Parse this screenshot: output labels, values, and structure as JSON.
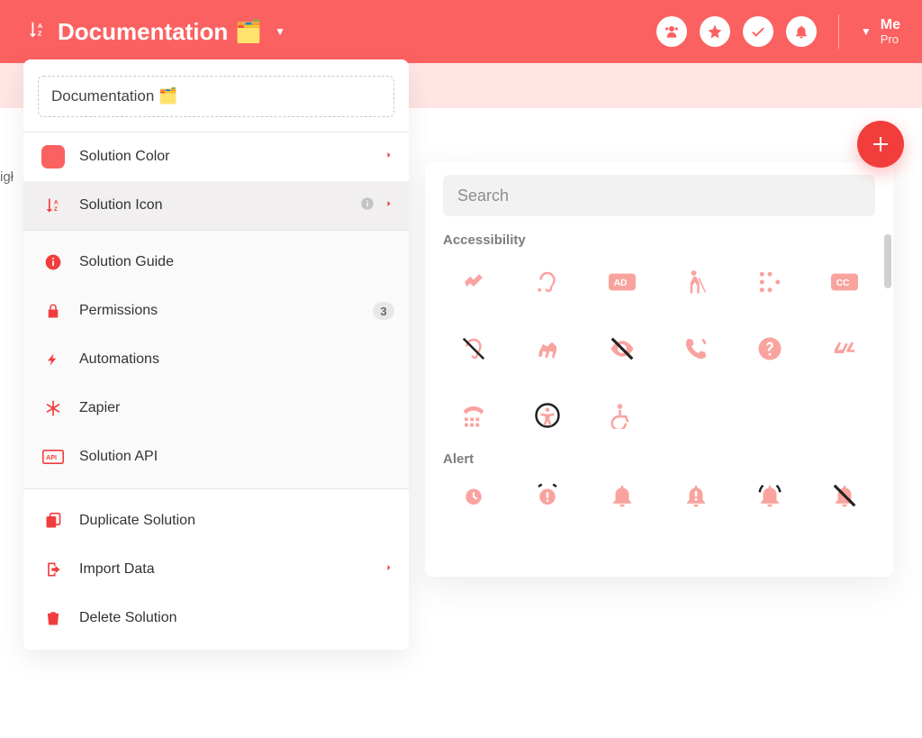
{
  "topbar": {
    "title": "Documentation",
    "emoji": "🗂️",
    "user": {
      "name": "Me",
      "sub": "Pro"
    }
  },
  "edge_label": "igł",
  "dropdown": {
    "name": "Documentation 🗂️",
    "rows": {
      "color": {
        "label": "Solution Color"
      },
      "icon": {
        "label": "Solution Icon"
      },
      "guide": {
        "label": "Solution Guide"
      },
      "permissions": {
        "label": "Permissions",
        "badge": "3"
      },
      "automations": {
        "label": "Automations"
      },
      "zapier": {
        "label": "Zapier"
      },
      "api": {
        "label": "Solution API"
      },
      "duplicate": {
        "label": "Duplicate Solution"
      },
      "import": {
        "label": "Import Data"
      },
      "delete": {
        "label": "Delete Solution"
      }
    }
  },
  "picker": {
    "search_placeholder": "Search",
    "sections": {
      "accessibility": {
        "label": "Accessibility"
      },
      "alert": {
        "label": "Alert"
      }
    }
  },
  "icons": {
    "accessibility": [
      "sign-language-icon",
      "assistive-listening-icon",
      "audio-description-icon",
      "blind-icon",
      "braille-icon",
      "closed-captioning-icon",
      "deaf-icon",
      "guide-dog-icon",
      "low-vision-icon",
      "phone-tty-icon",
      "question-circle-icon",
      "hands-icon",
      "tty-icon",
      "universal-access-icon",
      "wheelchair-icon"
    ],
    "alert": [
      "alarm-clock-icon",
      "alarm-exclamation-icon",
      "bell-icon",
      "bell-exclamation-icon",
      "bell-ring-icon",
      "bell-slash-icon"
    ]
  }
}
